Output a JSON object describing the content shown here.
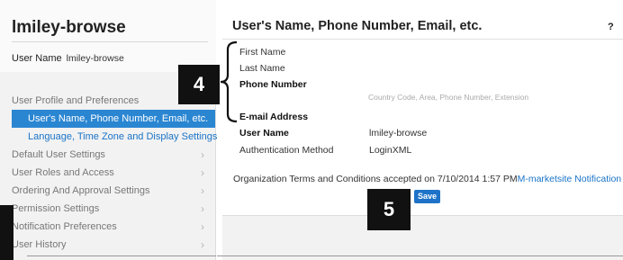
{
  "sidebar": {
    "title": "lmiley-browse",
    "user_label": "User Name",
    "user_value": "lmiley-browse",
    "section_title": "User Profile and Preferences",
    "sub_items": [
      {
        "label": "User's Name, Phone Number, Email, etc.",
        "active": true
      },
      {
        "label": "Language, Time Zone and Display Settings",
        "active": false
      }
    ],
    "items": [
      {
        "label": "Default User Settings"
      },
      {
        "label": "User Roles and Access"
      },
      {
        "label": "Ordering And Approval Settings"
      },
      {
        "label": "Permission Settings"
      },
      {
        "label": "Notification Preferences"
      },
      {
        "label": "User History"
      }
    ],
    "chevron": "›"
  },
  "main": {
    "title": "User's Name, Phone Number, Email, etc.",
    "help": "?",
    "first_name_label": "First Name",
    "last_name_label": "Last Name",
    "phone_label": "Phone Number",
    "phone_hint": "Country Code, Area, Phone Number, Extension",
    "email_label": "E-mail Address",
    "username_label": "User Name",
    "username_value": "lmiley-browse",
    "auth_label": "Authentication Method",
    "auth_value": "LoginXML",
    "terms_text": "Organization Terms and Conditions accepted on 7/10/2014 1:57 PM",
    "terms_link": "M-marketsite Notification",
    "save_label": "Save"
  },
  "callouts": {
    "four": "4",
    "five": "5"
  },
  "colors": {
    "accent": "#2b86d2",
    "link": "#1a73c8",
    "callout": "#111111"
  }
}
